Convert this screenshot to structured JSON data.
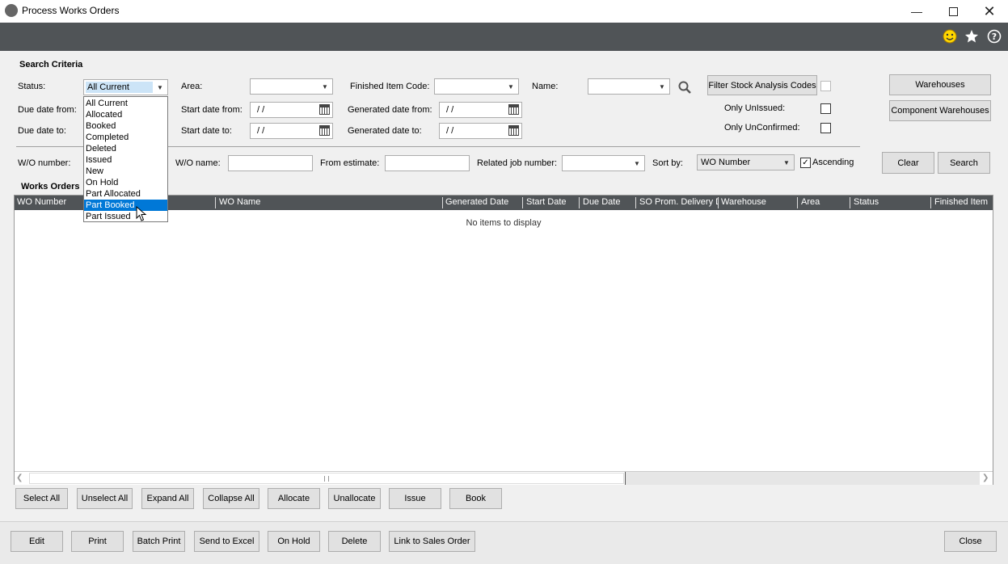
{
  "window": {
    "title": "Process Works Orders"
  },
  "search_criteria": {
    "heading": "Search Criteria",
    "status_label": "Status:",
    "status_value": "All Current",
    "area_label": "Area:",
    "finished_item_label": "Finished Item Code:",
    "name_label": "Name:",
    "filter_button": "Filter Stock Analysis Codes",
    "warehouses_button": "Warehouses",
    "component_warehouses_button": "Component Warehouses",
    "due_from_label": "Due date from:",
    "due_to_label": "Due date to:",
    "start_from_label": "Start date from:",
    "start_to_label": "Start date to:",
    "gen_from_label": "Generated date from:",
    "gen_to_label": "Generated date to:",
    "date_placeholder": "/ /",
    "only_unissued_label": "Only UnIssued:",
    "only_unconfirmed_label": "Only UnConfirmed:",
    "wo_number_label": "W/O number:",
    "wo_name_label": "W/O name:",
    "from_estimate_label": "From estimate:",
    "related_job_label": "Related job number:",
    "sort_by_label": "Sort by:",
    "sort_by_value": "WO Number",
    "ascending_label": "Ascending",
    "clear_button": "Clear",
    "search_button": "Search"
  },
  "status_dropdown": {
    "options": [
      "All Current",
      "Allocated",
      "Booked",
      "Completed",
      "Deleted",
      "Issued",
      "New",
      "On Hold",
      "Part Allocated",
      "Part Booked",
      "Part Issued"
    ],
    "highlighted": "Part Booked"
  },
  "works_orders": {
    "heading": "Works Orders",
    "columns": [
      "WO Number",
      "WO Name",
      "Generated Date",
      "Start Date",
      "Due Date",
      "SO Prom. Delivery D",
      "Warehouse",
      "Area",
      "Status",
      "Finished Item"
    ],
    "empty_text": "No items to display"
  },
  "row_buttons": [
    "Select All",
    "Unselect All",
    "Expand All",
    "Collapse All",
    "Allocate",
    "Unallocate",
    "Issue",
    "Book"
  ],
  "bottom_buttons": [
    "Edit",
    "Print",
    "Batch Print",
    "Send to Excel",
    "On Hold",
    "Delete",
    "Link to Sales Order"
  ],
  "close_button": "Close",
  "colors": {
    "header_dark": "#505457",
    "selection": "#0078d7"
  }
}
